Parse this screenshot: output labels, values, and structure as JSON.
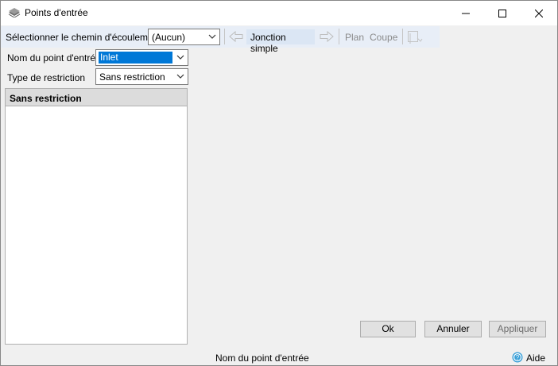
{
  "window": {
    "title": "Points d'entrée",
    "icon": "stack-icon",
    "controls": {
      "minimize": "minimize-icon",
      "maximize": "maximize-icon",
      "close": "close-icon"
    }
  },
  "toolbar": {
    "flow_path_label": "Sélectionner le chemin d'écoulement",
    "flow_path_value": "(Aucun)",
    "prev_icon": "arrow-left-icon",
    "junction_label": "Jonction simple",
    "next_icon": "arrow-right-icon",
    "plan_label": "Plan",
    "section_label": "Coupe",
    "extra_icon": "flag-icon"
  },
  "form": {
    "entry_name_label": "Nom du point d'entrée",
    "entry_name_value": "Inlet",
    "restriction_label": "Type de restriction",
    "restriction_value": "Sans restriction"
  },
  "panel": {
    "header": "Sans restriction"
  },
  "buttons": {
    "ok": "Ok",
    "cancel": "Annuler",
    "apply": "Appliquer"
  },
  "status": {
    "text": "Nom du point d'entrée",
    "help_label": "Aide",
    "help_icon": "help-icon"
  },
  "colors": {
    "selection": "#0078d7",
    "toolbar_bg": "#e8eef7",
    "help_icon": "#3aa0d8"
  }
}
